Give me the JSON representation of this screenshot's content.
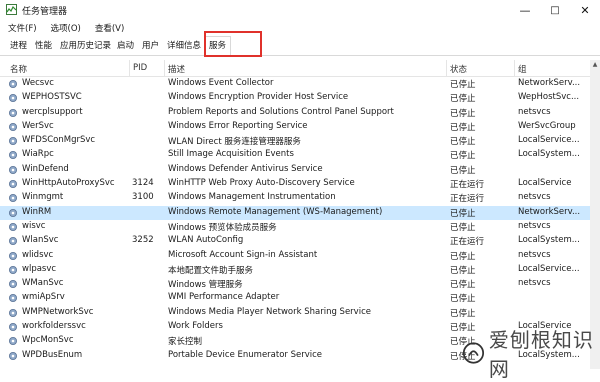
{
  "window": {
    "title": "任务管理器",
    "controls": {
      "minimize": "—",
      "maximize": "□",
      "close": "✕"
    }
  },
  "menu": [
    "文件(F)",
    "选项(O)",
    "查看(V)"
  ],
  "tabs": [
    "进程",
    "性能",
    "应用历史记录",
    "启动",
    "用户",
    "详细信息",
    "服务"
  ],
  "active_tab": "服务",
  "columns": {
    "name": "名称",
    "pid": "PID",
    "desc": "描述",
    "status": "状态",
    "group": "组"
  },
  "rows": [
    {
      "name": "Wecsvc",
      "pid": "",
      "desc": "Windows Event Collector",
      "status": "已停止",
      "group": "NetworkServ..."
    },
    {
      "name": "WEPHOSTSVC",
      "pid": "",
      "desc": "Windows Encryption Provider Host Service",
      "status": "已停止",
      "group": "WepHostSvc..."
    },
    {
      "name": "wercplsupport",
      "pid": "",
      "desc": "Problem Reports and Solutions Control Panel Support",
      "status": "已停止",
      "group": "netsvcs"
    },
    {
      "name": "WerSvc",
      "pid": "",
      "desc": "Windows Error Reporting Service",
      "status": "已停止",
      "group": "WerSvcGroup"
    },
    {
      "name": "WFDSConMgrSvc",
      "pid": "",
      "desc": "WLAN Direct 服务连接管理器服务",
      "status": "已停止",
      "group": "LocalService..."
    },
    {
      "name": "WiaRpc",
      "pid": "",
      "desc": "Still Image Acquisition Events",
      "status": "已停止",
      "group": "LocalSystem..."
    },
    {
      "name": "WinDefend",
      "pid": "",
      "desc": "Windows Defender Antivirus Service",
      "status": "已停止",
      "group": ""
    },
    {
      "name": "WinHttpAutoProxySvc",
      "pid": "3124",
      "desc": "WinHTTP Web Proxy Auto-Discovery Service",
      "status": "正在运行",
      "group": "LocalService"
    },
    {
      "name": "Winmgmt",
      "pid": "3100",
      "desc": "Windows Management Instrumentation",
      "status": "正在运行",
      "group": "netsvcs"
    },
    {
      "name": "WinRM",
      "pid": "",
      "desc": "Windows Remote Management (WS-Management)",
      "status": "已停止",
      "group": "NetworkServ..."
    },
    {
      "name": "wisvc",
      "pid": "",
      "desc": "Windows 预览体验成员服务",
      "status": "已停止",
      "group": "netsvcs"
    },
    {
      "name": "WlanSvc",
      "pid": "3252",
      "desc": "WLAN AutoConfig",
      "status": "正在运行",
      "group": "LocalSystem..."
    },
    {
      "name": "wlidsvc",
      "pid": "",
      "desc": "Microsoft Account Sign-in Assistant",
      "status": "已停止",
      "group": "netsvcs"
    },
    {
      "name": "wlpasvc",
      "pid": "",
      "desc": "本地配置文件助手服务",
      "status": "已停止",
      "group": "LocalService..."
    },
    {
      "name": "WManSvc",
      "pid": "",
      "desc": "Windows 管理服务",
      "status": "已停止",
      "group": "netsvcs"
    },
    {
      "name": "wmiApSrv",
      "pid": "",
      "desc": "WMI Performance Adapter",
      "status": "已停止",
      "group": ""
    },
    {
      "name": "WMPNetworkSvc",
      "pid": "",
      "desc": "Windows Media Player Network Sharing Service",
      "status": "已停止",
      "group": ""
    },
    {
      "name": "workfolderssvc",
      "pid": "",
      "desc": "Work Folders",
      "status": "已停止",
      "group": "LocalService"
    },
    {
      "name": "WpcMonSvc",
      "pid": "",
      "desc": "家长控制",
      "status": "已停止",
      "group": ""
    },
    {
      "name": "WPDBusEnum",
      "pid": "",
      "desc": "Portable Device Enumerator Service",
      "status": "已停止",
      "group": "LocalSystem..."
    }
  ],
  "selected_row": "WinRM",
  "watermark": "爱刨根知识网",
  "colors": {
    "highlight": "#e0312b",
    "selected": "#cce8ff"
  }
}
